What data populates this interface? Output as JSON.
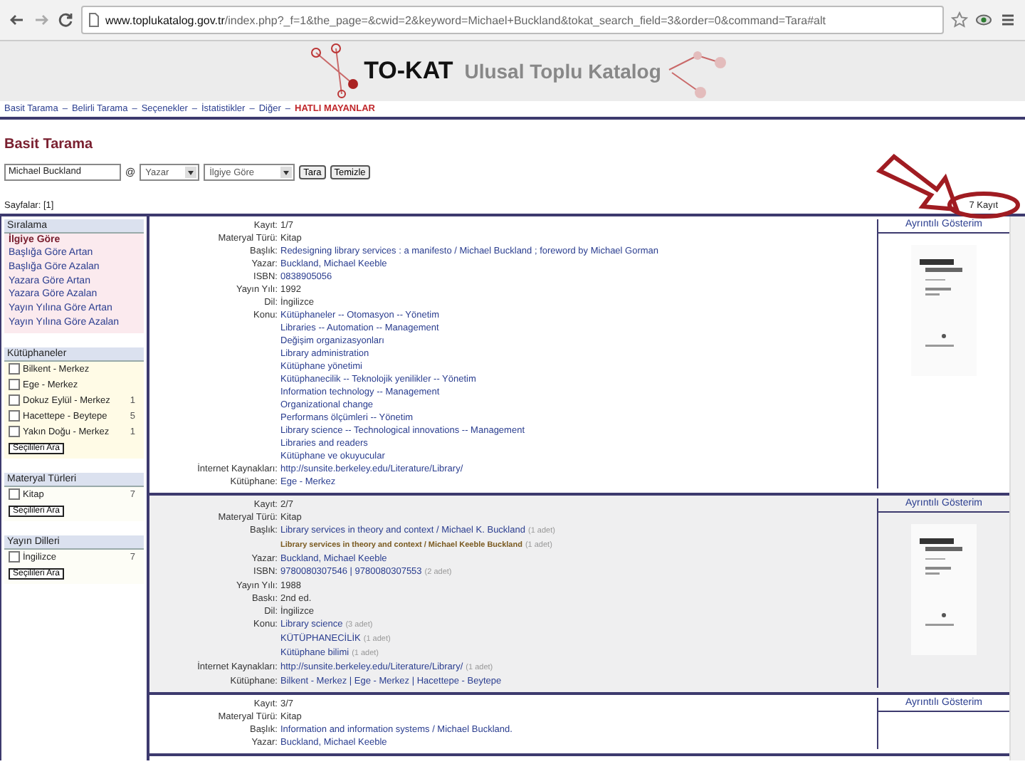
{
  "browser": {
    "url_host": "www.toplukatalog.gov.tr",
    "url_path": "/index.php?_f=1&the_page=&cwid=2&keyword=Michael+Buckland&tokat_search_field=3&order=0&command=Tara#alt"
  },
  "header": {
    "logo": "TO-KAT",
    "subtitle": "Ulusal Toplu Katalog"
  },
  "nav": [
    {
      "label": "Basit Tarama",
      "highlighted": false
    },
    {
      "label": "Belirli Tarama",
      "highlighted": false
    },
    {
      "label": "Seçenekler",
      "highlighted": false
    },
    {
      "label": "İstatistikler",
      "highlighted": false
    },
    {
      "label": "Diğer",
      "highlighted": false
    },
    {
      "label": "HATLI MAYANLAR",
      "highlighted": true
    }
  ],
  "nav_separator": "–",
  "page_title": "Basit Tarama",
  "search": {
    "value": "Michael Buckland",
    "at": "@",
    "field": "Yazar",
    "order": "İlgiye Göre",
    "buttons": [
      "Tara",
      "Temizle"
    ]
  },
  "pages": "Sayfalar: [1]",
  "total": "7 Kayıt",
  "sidebar": [
    {
      "title": "Sıralama",
      "kind": "sort",
      "color": "#fbeaee",
      "items": [
        {
          "label": "İlgiye Göre",
          "selected": true
        },
        {
          "label": "Başlığa Göre Artan",
          "selected": false
        },
        {
          "label": "Başlığa Göre Azalan",
          "selected": false
        },
        {
          "label": "Yazara Göre Artan",
          "selected": false
        },
        {
          "label": "Yazara Göre Azalan",
          "selected": false
        },
        {
          "label": "Yayın Yılına Göre Artan",
          "selected": false
        },
        {
          "label": "Yayın Yılına Göre Azalan",
          "selected": false
        }
      ]
    },
    {
      "title": "Kütüphaneler",
      "kind": "filter",
      "color": "#fffbe6",
      "button": "Seçilileri Ara",
      "items": [
        {
          "label": "Bilkent - Merkez",
          "checked": false
        },
        {
          "label": "Ege - Merkez",
          "checked": false
        },
        {
          "label": "Dokuz Eylül - Merkez",
          "checked": false,
          "count": "1"
        },
        {
          "label": "Hacettepe - Beytepe",
          "checked": false,
          "count": "5"
        },
        {
          "label": "Yakın Doğu - Merkez",
          "checked": false,
          "count": "1"
        }
      ]
    },
    {
      "title": "Materyal Türleri",
      "kind": "filter",
      "color": "#fdfdf6",
      "button": "Seçilileri Ara",
      "items": [
        {
          "label": "Kitap",
          "checked": false,
          "count": "7"
        }
      ]
    },
    {
      "title": "Yayın Dilleri",
      "kind": "filter",
      "color": "#fdfdf6",
      "button": "Seçilileri Ara",
      "items": [
        {
          "label": "İngilizce",
          "checked": false,
          "count": "7"
        }
      ]
    }
  ],
  "records": [
    {
      "selected": false,
      "detail_link": "Ayrıntılı Gösterim",
      "cover": {
        "kind": "picture"
      },
      "fields": [
        {
          "label": "Kayıt:",
          "values": [
            {
              "text": "1/7",
              "kind": "plain"
            }
          ]
        },
        {
          "label": "Materyal Türü:",
          "values": [
            {
              "text": "Kitap",
              "kind": "plain"
            }
          ]
        },
        {
          "label": "Başlık:",
          "values": [
            {
              "text": "Redesigning library services : a manifesto / Michael Buckland ; foreword by Michael Gorman",
              "kind": "link"
            }
          ]
        },
        {
          "label": "Yazar:",
          "values": [
            {
              "text": "Buckland, Michael Keeble",
              "kind": "link"
            }
          ]
        },
        {
          "label": "ISBN:",
          "values": [
            {
              "text": "0838905056",
              "kind": "link"
            }
          ]
        },
        {
          "label": "Yayın Yılı:",
          "values": [
            {
              "text": "1992",
              "kind": "plain"
            }
          ]
        },
        {
          "label": "Dil:",
          "values": [
            {
              "text": "İngilizce",
              "kind": "plain"
            }
          ]
        },
        {
          "label": "Konu:",
          "values": [
            {
              "text": "Kütüphaneler -- Otomasyon -- Yönetim",
              "kind": "link"
            },
            {
              "text": "Libraries -- Automation -- Management",
              "kind": "link"
            },
            {
              "text": "Değişim organizasyonları",
              "kind": "link"
            },
            {
              "text": "Library administration",
              "kind": "link"
            },
            {
              "text": "Kütüphane yönetimi",
              "kind": "link"
            },
            {
              "text": "Kütüphanecilik -- Teknolojik yenilikler -- Yönetim",
              "kind": "link"
            },
            {
              "text": "Information technology -- Management",
              "kind": "link"
            },
            {
              "text": "Organizational change",
              "kind": "link"
            },
            {
              "text": "Performans ölçümleri -- Yönetim",
              "kind": "link"
            },
            {
              "text": "Library science -- Technological innovations -- Management",
              "kind": "link"
            },
            {
              "text": "Libraries and readers",
              "kind": "link"
            },
            {
              "text": "Kütüphane ve okuyucular",
              "kind": "link"
            }
          ]
        },
        {
          "label": "İnternet Kaynakları:",
          "values": [
            {
              "text": "http://sunsite.berkeley.edu/Literature/Library/",
              "kind": "link"
            }
          ]
        },
        {
          "label": "Kütüphane:",
          "values": [
            {
              "text": "Ege - Merkez",
              "kind": "link"
            }
          ]
        }
      ]
    },
    {
      "selected": true,
      "detail_link": "Ayrıntılı Gösterim",
      "cover": {
        "kind": "picture"
      },
      "fields": [
        {
          "label": "Kayıt:",
          "values": [
            {
              "text": "2/7",
              "kind": "plain"
            }
          ]
        },
        {
          "label": "Materyal Türü:",
          "values": [
            {
              "text": "Kitap",
              "kind": "plain"
            }
          ]
        },
        {
          "label": "Başlık:",
          "values": [
            {
              "text": "Library services in theory and context / Michael K. Buckland",
              "kind": "link",
              "count": "(1 adet)"
            },
            {
              "text": "Library services in theory and context / Michael Keeble Buckland",
              "kind": "sub",
              "count": "(1 adet)"
            }
          ]
        },
        {
          "label": "Yazar:",
          "values": [
            {
              "text": "Buckland, Michael Keeble",
              "kind": "link"
            }
          ]
        },
        {
          "label": "ISBN:",
          "values": [
            {
              "text": "9780080307546 | 9780080307553",
              "kind": "link",
              "count": "(2 adet)"
            }
          ]
        },
        {
          "label": "Yayın Yılı:",
          "values": [
            {
              "text": "1988",
              "kind": "plain"
            }
          ]
        },
        {
          "label": "Baskı:",
          "values": [
            {
              "text": "2nd ed.",
              "kind": "plain"
            }
          ]
        },
        {
          "label": "Dil:",
          "values": [
            {
              "text": "İngilizce",
              "kind": "plain"
            }
          ]
        },
        {
          "label": "Konu:",
          "values": [
            {
              "text": "Library science",
              "kind": "link",
              "count": "(3 adet)"
            },
            {
              "text": "KÜTÜPHANECİLİK",
              "kind": "link",
              "count": "(1 adet)"
            },
            {
              "text": "Kütüphane bilimi",
              "kind": "link",
              "count": "(1 adet)"
            }
          ]
        },
        {
          "label": "İnternet Kaynakları:",
          "values": [
            {
              "text": "http://sunsite.berkeley.edu/Literature/Library/",
              "kind": "link",
              "count": "(1 adet)"
            }
          ]
        },
        {
          "label": "Kütüphane:",
          "values": [
            {
              "text": "Bilkent - Merkez | Ege - Merkez | Hacettepe - Beytepe",
              "kind": "link"
            }
          ]
        }
      ]
    },
    {
      "selected": false,
      "detail_link": "Ayrıntılı Gösterim",
      "fields": [
        {
          "label": "Kayıt:",
          "values": [
            {
              "text": "3/7",
              "kind": "plain"
            }
          ]
        },
        {
          "label": "Materyal Türü:",
          "values": [
            {
              "text": "Kitap",
              "kind": "plain"
            }
          ]
        },
        {
          "label": "Başlık:",
          "values": [
            {
              "text": "Information and information systems / Michael Buckland.",
              "kind": "link"
            }
          ]
        },
        {
          "label": "Yazar:",
          "values": [
            {
              "text": "Buckland, Michael Keeble",
              "kind": "link"
            }
          ]
        }
      ]
    }
  ]
}
